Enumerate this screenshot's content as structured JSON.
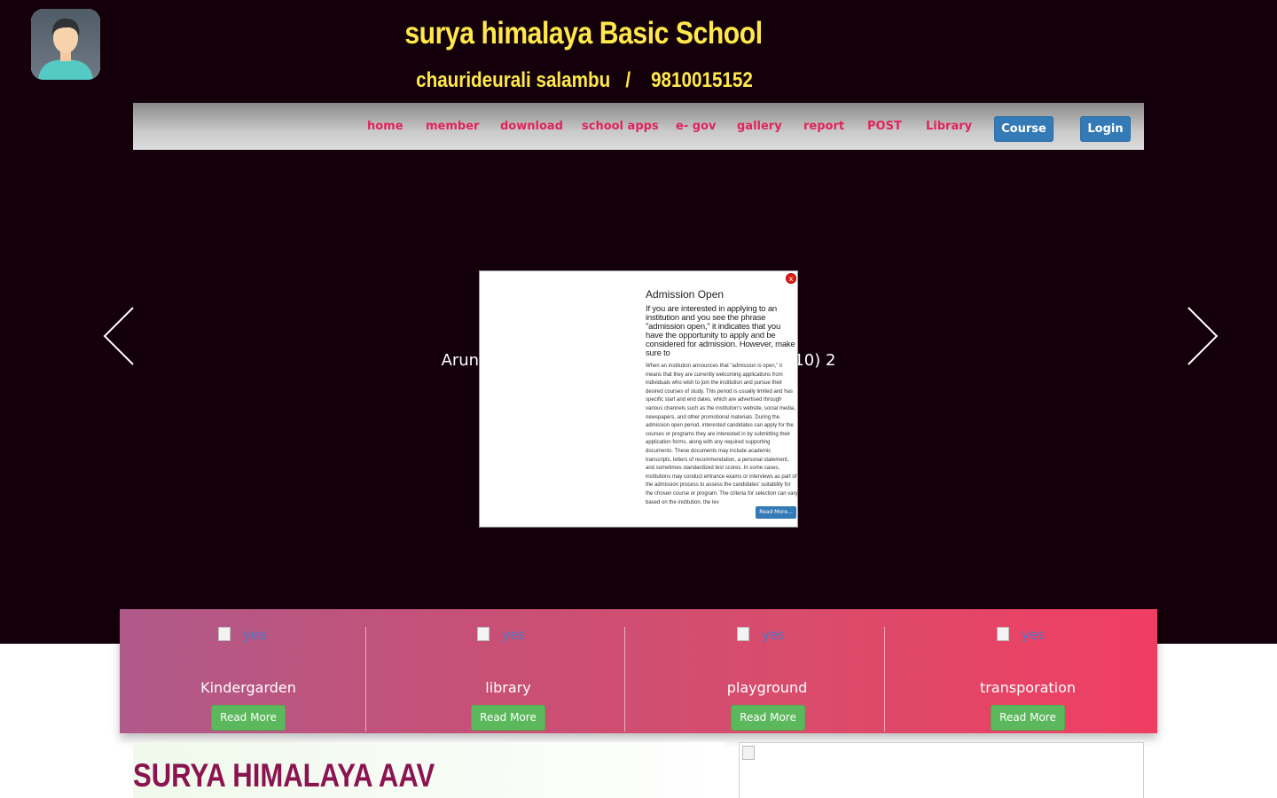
{
  "header": {
    "school_name": "surya himalaya Basic School",
    "subtitle": "chaurideurali salambu   /    9810015152"
  },
  "nav": {
    "links": [
      "home",
      "member",
      "download",
      "school apps",
      "e- gov",
      "gallery",
      "report",
      "POST",
      "Library"
    ],
    "course_button": "Course",
    "login_button": "Login"
  },
  "slider": {
    "caption": "Arunvalley Ebs, Chaurideurali Gaunpalika (010) 2"
  },
  "popup": {
    "close_label": "x",
    "title": "Admission Open",
    "intro": "If you are interested in applying to an institution and you see the phrase \"admission open,\" it indicates that you have the opportunity to apply and be considered for admission. However, make sure to",
    "body": "When an institution announces that \"admission is open,\" it means that they are currently welcoming applications from individuals who wish to join the institution and pursue their desired courses of study. This period is usually limited and has specific start and end dates, which are advertised through various channels such as the institution's website, social media, newspapers, and other promotional materials. During the admission open period, interested candidates can apply for the courses or programs they are interested in by submitting their application forms, along with any required supporting documents. These documents may include academic transcripts, letters of recommendation, a personal statement, and sometimes standardized test scores. In some cases, institutions may conduct entrance exams or interviews as part of the admission process to assess the candidates' suitability for the chosen course or program. The criteria for selection can vary based on the institution, the lev",
    "read_more": "Read More..."
  },
  "features": {
    "image_alt": "yes",
    "items": [
      {
        "label": "Kindergarden",
        "button": "Read More"
      },
      {
        "label": "library",
        "button": "Read More"
      },
      {
        "label": "playground",
        "button": "Read More"
      },
      {
        "label": "transporation",
        "button": "Read More"
      }
    ]
  },
  "bottom": {
    "heading": "SURYA HIMALAYA AAV"
  },
  "colors": {
    "background_dark": "#14000a",
    "title_yellow": "#ffe94a",
    "nav_link": "#e0245e",
    "button_blue": "#337ab7",
    "button_green": "#5cb85c",
    "heading_maroon": "#8b1450"
  },
  "icons": {
    "avatar": "user-avatar-icon",
    "prev": "chevron-left-icon",
    "next": "chevron-right-icon",
    "broken_image": "broken-image-icon"
  }
}
